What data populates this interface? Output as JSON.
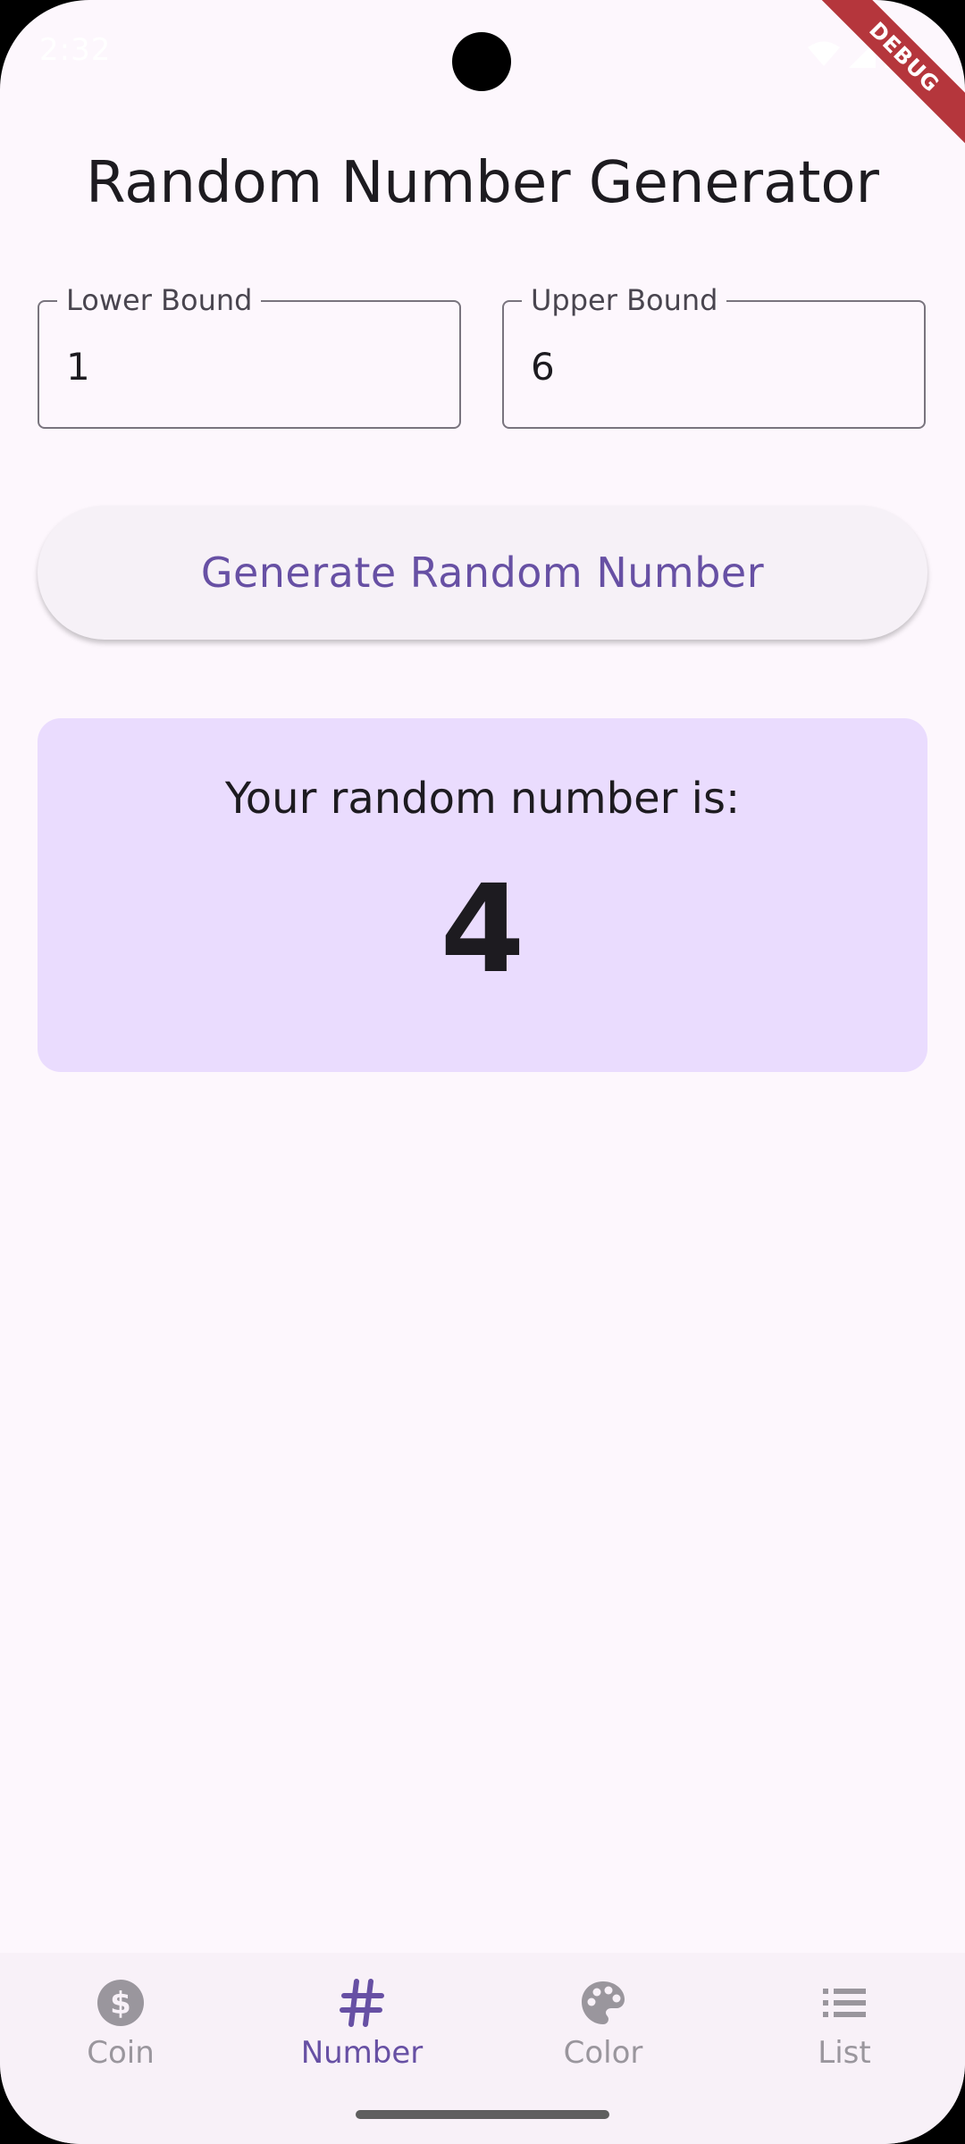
{
  "status_bar": {
    "time": "2:32",
    "debug_label": "DEBUG"
  },
  "page": {
    "title": "Random Number Generator"
  },
  "inputs": {
    "lower": {
      "label": "Lower Bound",
      "value": "1"
    },
    "upper": {
      "label": "Upper Bound",
      "value": "6"
    }
  },
  "generate_button": {
    "label": "Generate Random Number"
  },
  "result": {
    "label": "Your random number is:",
    "value": "4"
  },
  "bottom_nav": {
    "active": "Number",
    "items": [
      {
        "label": "Coin",
        "icon": "dollar-circle-icon"
      },
      {
        "label": "Number",
        "icon": "hash-icon"
      },
      {
        "label": "Color",
        "icon": "palette-icon"
      },
      {
        "label": "List",
        "icon": "list-icon"
      }
    ]
  },
  "colors": {
    "background": "#fdf7fd",
    "accent": "#6750a4",
    "result_card": "#eadcfe",
    "debug_ribbon": "#b5363c",
    "inactive_nav": "#9a969d"
  }
}
